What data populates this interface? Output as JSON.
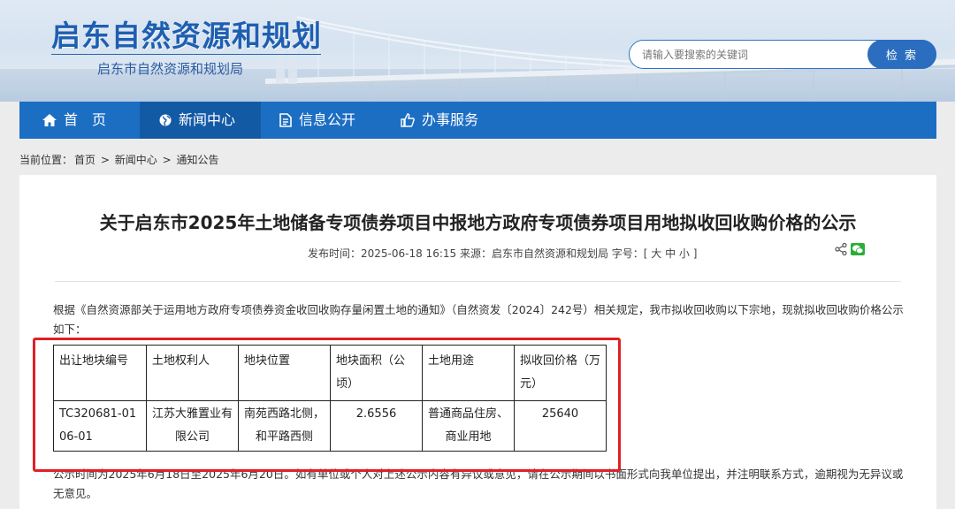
{
  "header": {
    "site_title": "启东自然资源和规划",
    "site_subtitle": "启东市自然资源和规划局",
    "search_placeholder": "请输入要搜索的关键词",
    "search_button": "检 索"
  },
  "nav": {
    "items": [
      {
        "label": "首　页",
        "icon": "home-icon"
      },
      {
        "label": "新闻中心",
        "icon": "globe-icon",
        "active": true
      },
      {
        "label": "信息公开",
        "icon": "document-icon"
      },
      {
        "label": "办事服务",
        "icon": "thumbs-up-icon"
      }
    ]
  },
  "breadcrumb": {
    "prefix": "当前位置：",
    "items": [
      "首页",
      "新闻中心",
      "通知公告"
    ],
    "separator": ">"
  },
  "article": {
    "title": "关于启东市2025年土地储备专项债券项目中报地方政府专项债券项目用地拟收回收购价格的公示",
    "meta": "发布时间：2025-06-18 16:15  来源：启东市自然资源和规划局  字号：[ 大 中 小 ]",
    "paragraph_1": "根据《自然资源部关于运用地方政府专项债券资金收回收购存量闲置土地的通知》（自然资发〔2024〕242号）相关规定，我市拟收回收购以下宗地，现就拟收回收购价格公示如下：",
    "paragraph_2": "公示时间为2025年6月18日至2025年6月20日。如有单位或个人对上述公示内容有异议或意见，请在公示期间以书面形式向我单位提出，并注明联系方式，逾期视为无异议或无意见。"
  },
  "table": {
    "headers": [
      "出让地块编号",
      "土地权利人",
      "地块位置",
      "地块面积（公顷）",
      "土地用途",
      "拟收回价格（万元）"
    ],
    "rows": [
      [
        "TC320681-0106-01",
        "江苏大雅置业有限公司",
        "南苑西路北侧，和平路西侧",
        "2.6556",
        "普通商品住房、商业用地",
        "25640"
      ]
    ]
  },
  "colors": {
    "nav_bg": "#1c6ec3",
    "nav_active": "#135aa5",
    "title_blue": "#1f5fb0",
    "highlight_red": "#e02026"
  }
}
